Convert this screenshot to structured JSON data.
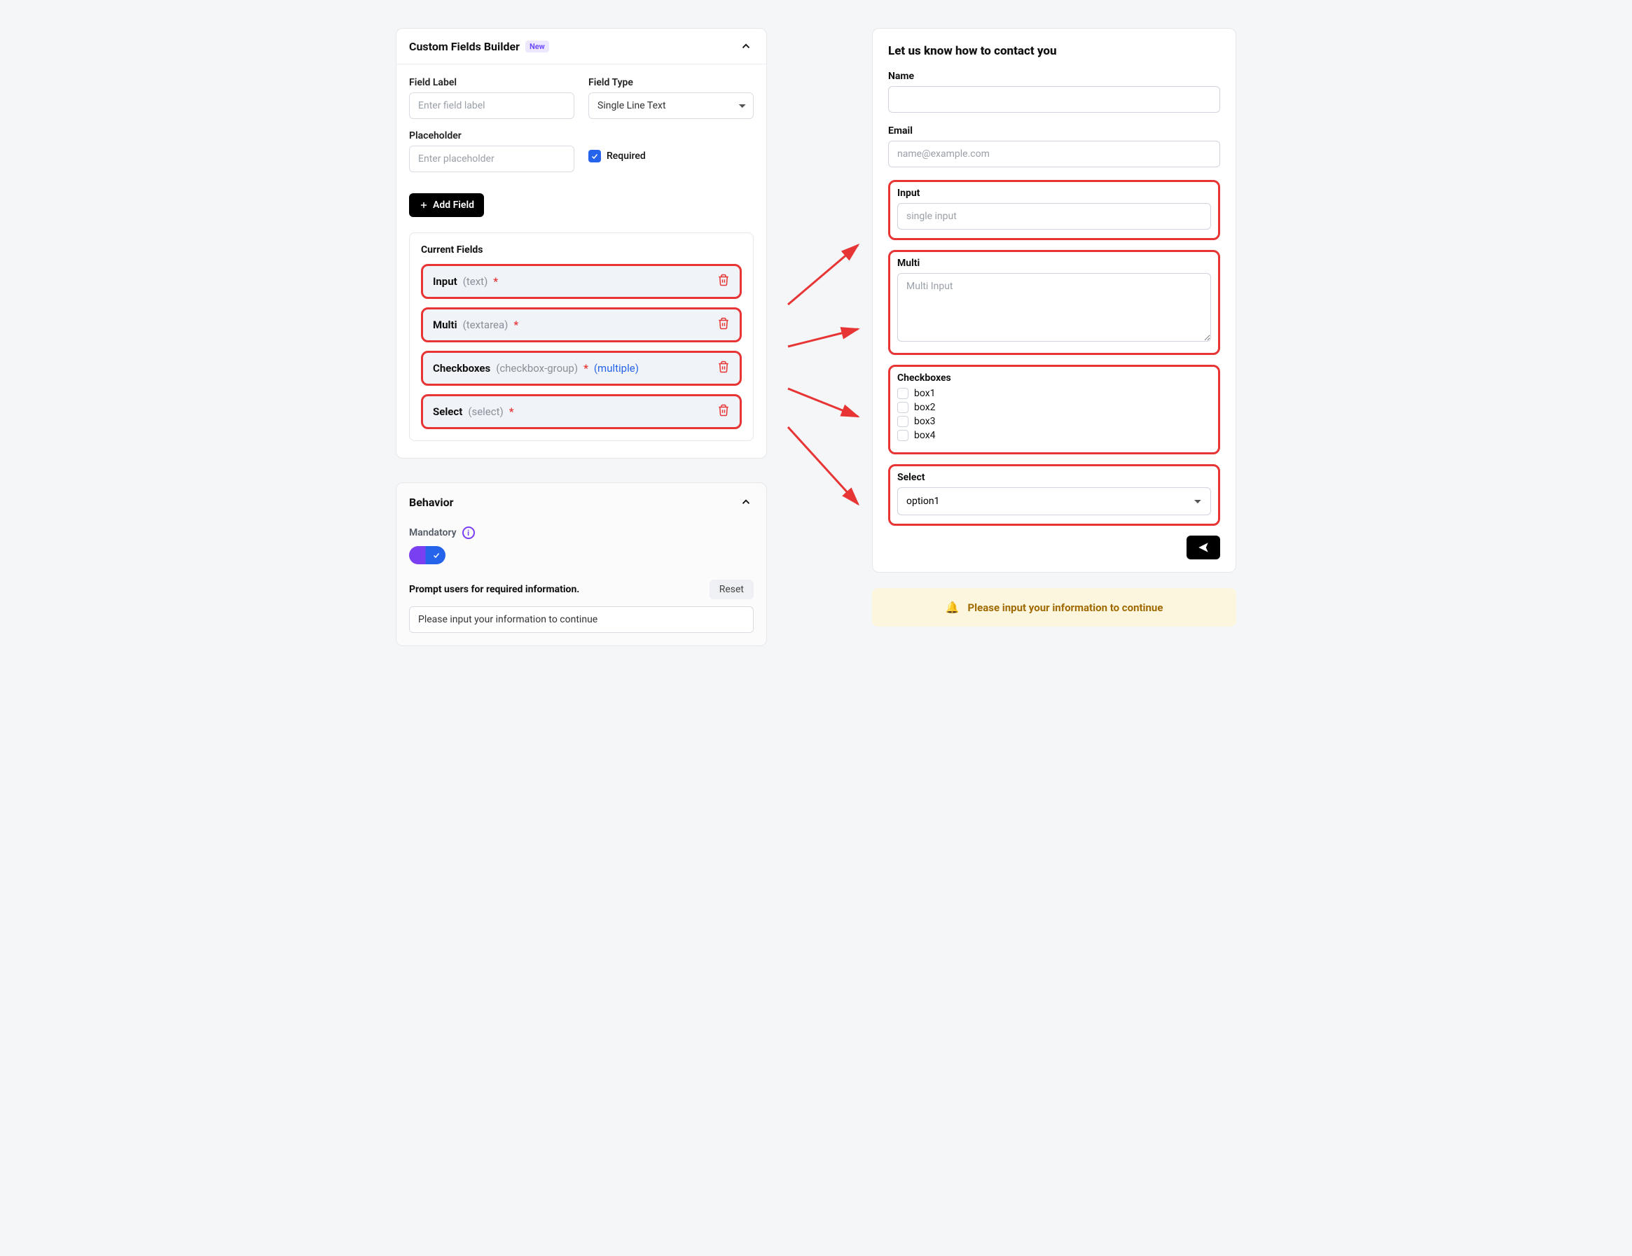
{
  "builder": {
    "title": "Custom Fields Builder",
    "new_badge": "New",
    "field_label_label": "Field Label",
    "field_label_placeholder": "Enter field label",
    "field_type_label": "Field Type",
    "field_type_value": "Single Line Text",
    "placeholder_label": "Placeholder",
    "placeholder_placeholder": "Enter placeholder",
    "required_label": "Required",
    "add_field_label": "Add Field",
    "current_fields_title": "Current Fields",
    "fields": [
      {
        "name": "Input",
        "type": "(text)",
        "star": "*",
        "mult": ""
      },
      {
        "name": "Multi",
        "type": "(textarea)",
        "star": "*",
        "mult": ""
      },
      {
        "name": "Checkboxes",
        "type": "(checkbox-group)",
        "star": "*",
        "mult": "(multiple)"
      },
      {
        "name": "Select",
        "type": "(select)",
        "star": "*",
        "mult": ""
      }
    ]
  },
  "behavior": {
    "title": "Behavior",
    "mandatory_label": "Mandatory",
    "prompt_label": "Prompt users for required information.",
    "reset_label": "Reset",
    "prompt_value": "Please input your information to continue"
  },
  "preview": {
    "title": "Let us know how to contact you",
    "name_label": "Name",
    "email_label": "Email",
    "email_placeholder": "name@example.com",
    "input_label": "Input",
    "input_placeholder": "single input",
    "multi_label": "Multi",
    "multi_placeholder": "Multi Input",
    "checkboxes_label": "Checkboxes",
    "checkboxes": [
      "box1",
      "box2",
      "box3",
      "box4"
    ],
    "select_label": "Select",
    "select_value": "option1"
  },
  "banner": {
    "text": "Please input your information to continue"
  }
}
